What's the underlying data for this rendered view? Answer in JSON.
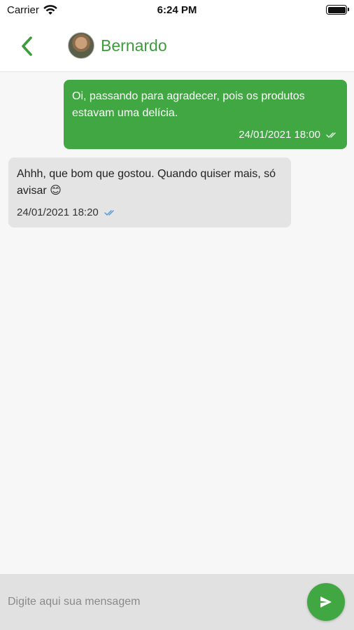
{
  "status_bar": {
    "carrier": "Carrier",
    "time": "6:24 PM",
    "wifi_icon": "wifi-icon",
    "battery_icon": "battery-icon"
  },
  "header": {
    "back_icon": "chevron-left-icon",
    "contact_name": "Bernardo",
    "accent_color": "#3c9c3c"
  },
  "messages": [
    {
      "direction": "sent",
      "text": "Oi, passando para  agradecer, pois os produtos estavam uma delícia.",
      "timestamp": "24/01/2021 18:00",
      "status_icon": "double-check-icon"
    },
    {
      "direction": "received",
      "text": "Ahhh, que bom que gostou. Quando quiser mais, só avisar 😊",
      "timestamp": "24/01/2021 18:20",
      "status_icon": "double-check-icon"
    }
  ],
  "composer": {
    "placeholder": "Digite aqui sua mensagem",
    "value": "",
    "send_icon": "send-icon"
  },
  "colors": {
    "sent_bubble": "#41a743",
    "received_bubble": "#e4e4e4",
    "read_check": "#5b9bd5",
    "input_bar": "#e1e1e1"
  }
}
